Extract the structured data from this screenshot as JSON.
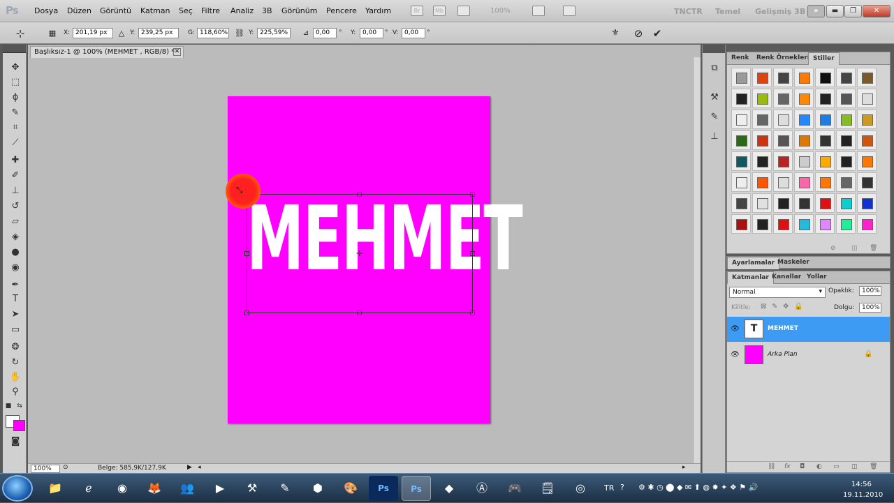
{
  "app": {
    "logo": "Ps"
  },
  "menu": [
    "Dosya",
    "Düzen",
    "Görüntü",
    "Katman",
    "Seç",
    "Filtre",
    "Analiz",
    "3B",
    "Görünüm",
    "Pencere",
    "Yardım"
  ],
  "menubar_extra": {
    "bridge": "Br",
    "minibridge": "Mb",
    "zoom": "100%"
  },
  "workspaces": [
    "TNCTR",
    "Temel",
    "Gelişmiş 3B"
  ],
  "window_controls": {
    "more": "»",
    "minimize": "▬",
    "restore": "❐",
    "close": "✕"
  },
  "options": {
    "x_label": "X:",
    "x_value": "201,19 px",
    "y_label": "Y:",
    "y_value": "239,25 px",
    "w_label": "G:",
    "w_value": "118,60%",
    "h_label": "Y:",
    "h_value": "225,59%",
    "angle_value": "0,00",
    "angle_unit": "°",
    "hskew_label": "Y:",
    "hskew_value": "0,00",
    "hskew_unit": "°",
    "vskew_label": "V:",
    "vskew_value": "0,00",
    "vskew_unit": "°"
  },
  "document": {
    "tab_title": "Başlıksız-1 @ 100% (MEHMET , RGB/8) *",
    "canvas_text": "MEHMET",
    "canvas_color": "#ff00ff"
  },
  "status": {
    "zoom": "100%",
    "doc_size": "Belge: 585,9K/127,9K"
  },
  "styles_panel": {
    "tabs": [
      "Renk",
      "Renk Örnekleri",
      "Stiller"
    ],
    "swatches": [
      "#9a9a9a",
      "#e0440e",
      "#444444",
      "#ff7a00",
      "#111111",
      "#444444",
      "#7a5a2a",
      "#222222",
      "#99bb11",
      "#666666",
      "#ff8800",
      "#222222",
      "#555555",
      "#dddddd",
      "#eeeeee",
      "#666666",
      "#dddddd",
      "#2288ff",
      "#1a7fe0",
      "#88bb22",
      "#cc9922",
      "#2a6a14",
      "#cc3311",
      "#555555",
      "#dd7700",
      "#333333",
      "#222222",
      "#cc5511",
      "#0e5a60",
      "#222222",
      "#bb2222",
      "#cccccc",
      "#ffaa00",
      "#222222",
      "#ff7700",
      "#eeeeee",
      "#ff5500",
      "#dddddd",
      "#ff66aa",
      "#ff7700",
      "#666666",
      "#333333",
      "#444444",
      "#e0e0e0",
      "#222222",
      "#333333",
      "#dd1111",
      "#11cccc",
      "#1133cc",
      "#aa1111",
      "#222222",
      "#dd1111",
      "#22bbdd",
      "#dd88ff",
      "#22ee99",
      "#ff22cc"
    ]
  },
  "adjust_tabs": [
    "Ayarlamalar",
    "Maskeler"
  ],
  "layers_panel": {
    "tabs": [
      "Katmanlar",
      "Kanallar",
      "Yollar"
    ],
    "blend_mode": "Normal",
    "opacity_label": "Opaklık:",
    "opacity_value": "100%",
    "lock_label": "Kilitle:",
    "fill_label": "Dolgu:",
    "fill_value": "100%",
    "layers": [
      {
        "name": "MEHMET",
        "thumb": "T"
      },
      {
        "name": "Arka Plan"
      }
    ]
  },
  "taskbar": {
    "apps": [
      "folder",
      "ie",
      "chrome",
      "firefox",
      "messenger",
      "media",
      "tools",
      "pen",
      "pinball",
      "paint",
      "Ps",
      "Ps",
      "media2",
      "avast",
      "game",
      "note",
      "target"
    ],
    "language": "TR",
    "time": "14:56",
    "date": "19.11.2010"
  }
}
